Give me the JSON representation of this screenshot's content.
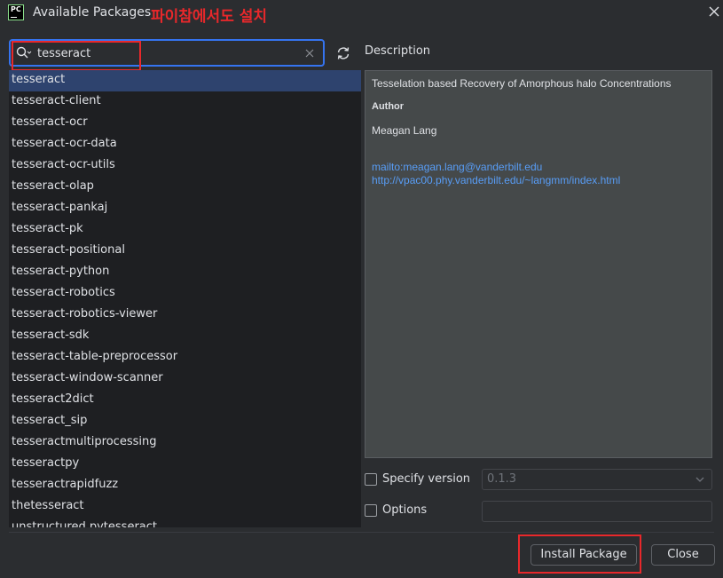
{
  "window": {
    "app_icon_text": "PC",
    "title": "Available Packages",
    "annotation": "파이참에서도 설치"
  },
  "search": {
    "value": "tesseract"
  },
  "packages": [
    "tesseract",
    "tesseract-client",
    "tesseract-ocr",
    "tesseract-ocr-data",
    "tesseract-ocr-utils",
    "tesseract-olap",
    "tesseract-pankaj",
    "tesseract-pk",
    "tesseract-positional",
    "tesseract-python",
    "tesseract-robotics",
    "tesseract-robotics-viewer",
    "tesseract-sdk",
    "tesseract-table-preprocessor",
    "tesseract-window-scanner",
    "tesseract2dict",
    "tesseract_sip",
    "tesseractmultiprocessing",
    "tesseractpy",
    "tesseractrapidfuzz",
    "thetesseract",
    "unstructured.pytesseract"
  ],
  "selected_index": 0,
  "description": {
    "label": "Description",
    "summary": "Tesselation based Recovery of Amorphous halo Concentrations",
    "author_label": "Author",
    "author": "Meagan Lang",
    "email_link": "mailto:meagan.lang@vanderbilt.edu",
    "homepage_link": "http://vpac00.phy.vanderbilt.edu/~langmm/index.html"
  },
  "options": {
    "specify_version_label": "Specify version",
    "specify_version_checked": false,
    "version_value": "0.1.3",
    "options_label": "Options",
    "options_checked": false
  },
  "buttons": {
    "install": "Install Package",
    "close": "Close"
  },
  "colors": {
    "accent": "#3574f0",
    "selection": "#2e436e",
    "highlight_annotation": "#e8282b",
    "link": "#589df6"
  }
}
